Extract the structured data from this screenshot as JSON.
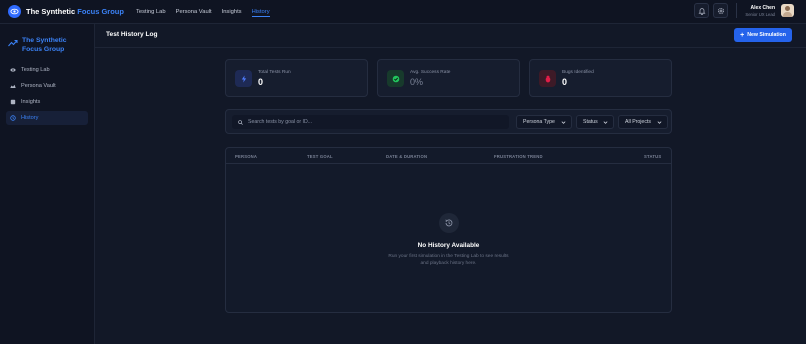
{
  "app": {
    "name_main": "The Synthetic",
    "name_accent": "Focus Group"
  },
  "topnav": {
    "items": [
      {
        "label": "Testing Lab"
      },
      {
        "label": "Persona Vault"
      },
      {
        "label": "Insights"
      },
      {
        "label": "History"
      }
    ],
    "active": "History"
  },
  "user": {
    "name": "Alex Chen",
    "role": "Senior UX Lead"
  },
  "sidebar": {
    "brand_line1": "The Synthetic",
    "brand_line2": "Focus Group",
    "items": [
      {
        "label": "Testing Lab",
        "icon": "flask-icon"
      },
      {
        "label": "Persona Vault",
        "icon": "users-icon"
      },
      {
        "label": "Insights",
        "icon": "chart-icon"
      },
      {
        "label": "History",
        "icon": "history-icon"
      }
    ]
  },
  "header": {
    "title": "Test History Log",
    "new_button": "New Simulation"
  },
  "stats": [
    {
      "label": "Total Tests Run",
      "value": "0",
      "icon": "lightning-icon",
      "color": "#3b5bdb"
    },
    {
      "label": "Avg. Success Rate",
      "value": "0%",
      "icon": "check-circle-icon",
      "color": "#22c55e"
    },
    {
      "label": "Bugs Identified",
      "value": "0",
      "icon": "bug-icon",
      "color": "#e11d48"
    }
  ],
  "filters": {
    "search_placeholder": "Search tests by goal or ID...",
    "persona_type": "Persona Type",
    "status": "Status",
    "projects": "All Projects"
  },
  "table": {
    "columns": [
      "PERSONA",
      "TEST GOAL",
      "DATE & DURATION",
      "FRUSTRATION TREND",
      "STATUS"
    ],
    "empty_title": "No History Available",
    "empty_desc": "Run your first simulation in the Testing Lab to see results and playback history here."
  },
  "colors": {
    "accent": "#3b82f6",
    "background": "#121827",
    "button": "#2563eb"
  }
}
